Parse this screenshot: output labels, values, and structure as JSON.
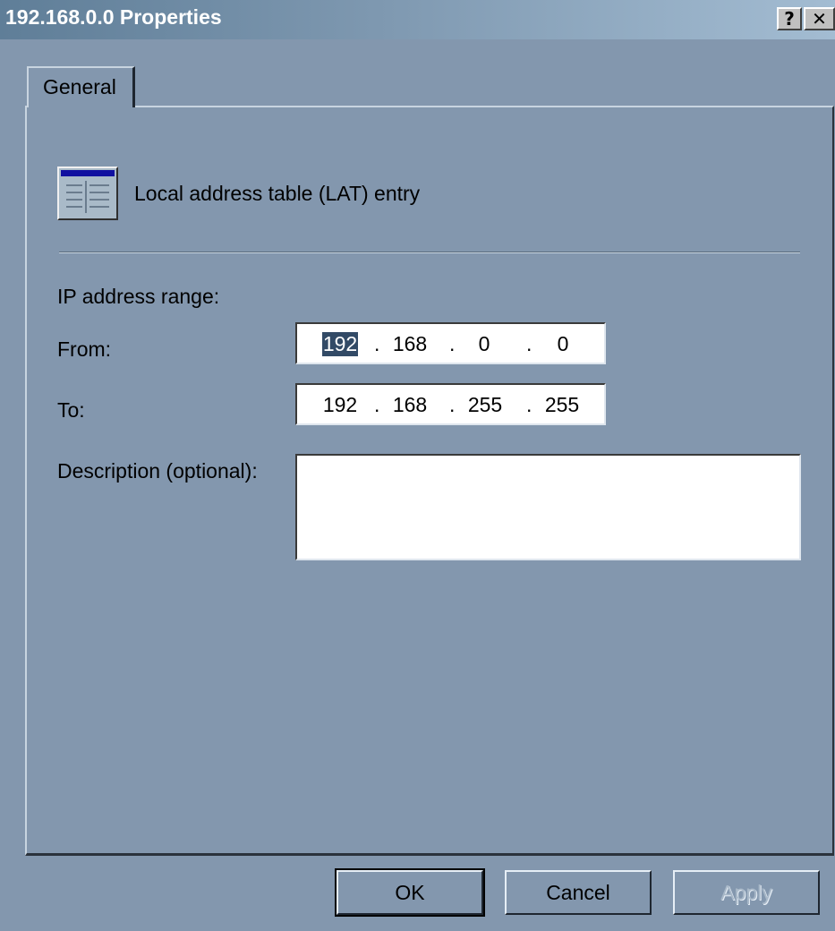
{
  "window": {
    "title": "192.168.0.0 Properties",
    "help_button": "?",
    "close_button": "✕"
  },
  "tabs": [
    {
      "label": "General",
      "active": true
    }
  ],
  "general": {
    "icon": "lat-table-icon",
    "heading": "Local address table (LAT) entry",
    "ip_range_label": "IP address range:",
    "from_label": "From:",
    "to_label": "To:",
    "description_label": "Description (optional):",
    "from_octets": [
      "192",
      "168",
      "0",
      "0"
    ],
    "to_octets": [
      "192",
      "168",
      "255",
      "255"
    ],
    "description_value": ""
  },
  "buttons": {
    "ok": "OK",
    "cancel": "Cancel",
    "apply": "Apply"
  },
  "colors": {
    "background": "#8397ae",
    "selection": "#324a66",
    "titlebar_start": "#5f7e98",
    "titlebar_end": "#a3bcd2"
  }
}
